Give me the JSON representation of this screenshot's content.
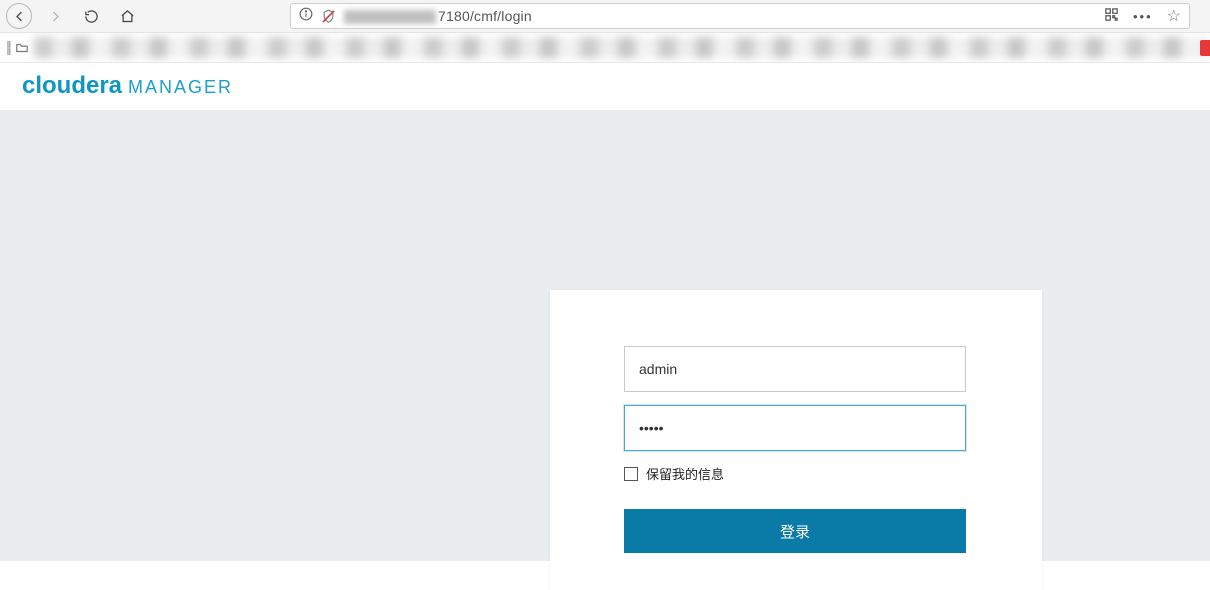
{
  "browser": {
    "url_suffix": "7180/cmf/login"
  },
  "brand": {
    "primary": "cloudera",
    "secondary": "MANAGER"
  },
  "login": {
    "username_value": "admin",
    "password_value": "•••••",
    "remember_label": "保留我的信息",
    "submit_label": "登录"
  }
}
